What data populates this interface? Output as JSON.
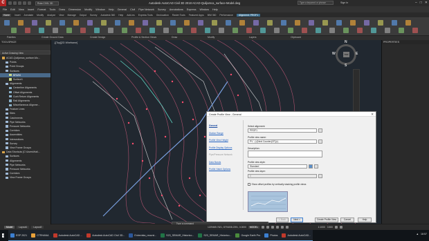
{
  "title_bar": {
    "workspace": "Ruta CIVIL 3D",
    "title": "Autodesk AutoCAD Civil 3D 2018   ACAD-Quiljamca_surface-Model.dwg",
    "search_placeholder": "Type a keyword or phrase",
    "sign_in": "Sign In",
    "window_buttons": [
      "–",
      "□",
      "✕"
    ]
  },
  "menu": [
    "File",
    "Edit",
    "View",
    "Insert",
    "Format",
    "Tools",
    "Draw",
    "Dimension",
    "Modify",
    "Window",
    "Help",
    "General",
    "Civil",
    "Pipe Network",
    "Survey",
    "Annotations",
    "Express",
    "Window",
    "Help"
  ],
  "ribbon_tabs": [
    "Home",
    "Insert",
    "Annotate",
    "Modify",
    "Analyze",
    "View",
    "Manage",
    "Output",
    "Survey",
    "Autodesk 360",
    "Help",
    "Add-ins",
    "Express Tools",
    "Geolocation",
    "Raster Tools",
    "Featured Apps",
    "BIM 360",
    "Performance"
  ],
  "ribbon_context_tab": "Alignment: PROF1",
  "ribbon_panels": [
    "Palettes",
    "Create Ground Data",
    "Create Design",
    "Profile & Section Views",
    "Draw",
    "Modify",
    "Layers",
    "Clipboard"
  ],
  "viewport_label": "-][Top][2D Wireframe]",
  "toolspace": {
    "title": "TOOLSPACE",
    "view_label": "Active Drawing View",
    "tree": [
      {
        "label": "ACAD-Quiljamca_surface-Mo...",
        "indent": 0,
        "sel": false,
        "color": "#d9a44a"
      },
      {
        "label": "Points",
        "indent": 1,
        "sel": false,
        "color": "#9fb9d6"
      },
      {
        "label": "Point Groups",
        "indent": 1,
        "sel": false,
        "color": "#9fb9d6"
      },
      {
        "label": "Surfaces",
        "indent": 1,
        "sel": false,
        "color": "#9fb9d6"
      },
      {
        "label": "BRUNI",
        "indent": 2,
        "sel": true,
        "color": "#c8d88a"
      },
      {
        "label": "Surface1",
        "indent": 2,
        "sel": false,
        "color": "#c8d88a"
      },
      {
        "label": "Alignments",
        "indent": 1,
        "sel": false,
        "color": "#9fb9d6"
      },
      {
        "label": "Centerline Alignments",
        "indent": 2,
        "sel": false,
        "color": "#8ab0c8"
      },
      {
        "label": "Offset Alignments",
        "indent": 2,
        "sel": false,
        "color": "#8ab0c8"
      },
      {
        "label": "Curb Return Alignments",
        "indent": 2,
        "sel": false,
        "color": "#8ab0c8"
      },
      {
        "label": "Rail Alignments",
        "indent": 2,
        "sel": false,
        "color": "#8ab0c8"
      },
      {
        "label": "Miscellaneous Alignme...",
        "indent": 2,
        "sel": false,
        "color": "#8ab0c8"
      },
      {
        "label": "Feature Lines",
        "indent": 1,
        "sel": false,
        "color": "#9fb9d6"
      },
      {
        "label": "Sites",
        "indent": 1,
        "sel": false,
        "color": "#9fb9d6"
      },
      {
        "label": "Catchments",
        "indent": 1,
        "sel": false,
        "color": "#9fb9d6"
      },
      {
        "label": "Pipe Networks",
        "indent": 1,
        "sel": false,
        "color": "#9fb9d6"
      },
      {
        "label": "Pressure Networks",
        "indent": 1,
        "sel": false,
        "color": "#9fb9d6"
      },
      {
        "label": "Corridors",
        "indent": 1,
        "sel": false,
        "color": "#9fb9d6"
      },
      {
        "label": "Assemblies",
        "indent": 1,
        "sel": false,
        "color": "#9fb9d6"
      },
      {
        "label": "Intersections",
        "indent": 1,
        "sel": false,
        "color": "#9fb9d6"
      },
      {
        "label": "Survey",
        "indent": 1,
        "sel": false,
        "color": "#9fb9d6"
      },
      {
        "label": "View Frame Groups",
        "indent": 1,
        "sel": false,
        "color": "#9fb9d6"
      },
      {
        "label": "Data Shortcuts [C:\\Users\\Hali...",
        "indent": 0,
        "sel": false,
        "color": "#d9a44a"
      },
      {
        "label": "Surfaces",
        "indent": 1,
        "sel": false,
        "color": "#9fb9d6"
      },
      {
        "label": "Alignments",
        "indent": 1,
        "sel": false,
        "color": "#9fb9d6"
      },
      {
        "label": "Pipe Networks",
        "indent": 1,
        "sel": false,
        "color": "#9fb9d6"
      },
      {
        "label": "Pressure Networks",
        "indent": 1,
        "sel": false,
        "color": "#9fb9d6"
      },
      {
        "label": "Corridors",
        "indent": 1,
        "sel": false,
        "color": "#9fb9d6"
      },
      {
        "label": "View Frame Groups",
        "indent": 1,
        "sel": false,
        "color": "#9fb9d6"
      }
    ]
  },
  "navcube": {
    "top": "TOP",
    "n": "N",
    "s": "S",
    "e": "E",
    "w": "W"
  },
  "properties_title": "PROPERTIES",
  "dialog": {
    "title": "Create Profile View - General",
    "close": "✕",
    "nav": [
      {
        "label": "General",
        "state": "active"
      },
      {
        "label": "Station Range",
        "state": "link"
      },
      {
        "label": "Profile View Height",
        "state": "link"
      },
      {
        "label": "Profile Display Options",
        "state": "link"
      },
      {
        "label": "Pipe/Pressure Network",
        "state": "disabled"
      },
      {
        "label": "Data Bands",
        "state": "link"
      },
      {
        "label": "Profile Hatch Options",
        "state": "link"
      }
    ],
    "select_alignment_label": "Select alignment:",
    "select_alignment_value": "PROF1",
    "profile_view_name_label": "Profile view name:",
    "profile_view_name_value": "PV - (<[Next Counter(CP)]>)",
    "description_label": "Description:",
    "description_value": "",
    "profile_view_style_label": "Profile view style:",
    "profile_view_style_value": "Standard",
    "profile_view_layer_label": "Profile view layer:",
    "profile_view_layer_value": "0",
    "show_offset_label": "Show offset profiles by vertically stacking profile views",
    "buttons": {
      "back": "< Back",
      "next": "Next >",
      "create": "Create Profile View",
      "cancel": "Cancel",
      "help": "Help"
    }
  },
  "command_line": "_ Type a command",
  "layout_tabs": [
    "Model",
    "Layout1",
    "Layout2"
  ],
  "status": {
    "coords": "1229465.7621, 8791838.2391, 0.0000",
    "model": "MODEL",
    "scale": "1:1000",
    "decimal": "3.500"
  },
  "taskbar": {
    "items": [
      {
        "label": "ESP 2021",
        "color": "#3c7fd1"
      },
      {
        "label": "CTRHANA",
        "color": "#e8a13a"
      },
      {
        "label": "Autodesk AutoCAD ...",
        "color": "#c0392b"
      },
      {
        "label": "Autodesk AutoCAD Civil 3D...",
        "color": "#c0392b"
      },
      {
        "label": "Entrevista_recursi...",
        "color": "#2b579a"
      },
      {
        "label": "S23_SEMAR_Historico...",
        "color": "#217346"
      },
      {
        "label": "S23_SEMAR_Historico...",
        "color": "#217346"
      },
      {
        "label": "Google Earth Pro",
        "color": "#4a8a3c"
      },
      {
        "label": "Photos",
        "color": "#3c7fd1"
      },
      {
        "label": "Autodesk AutoCAD...",
        "color": "#c0392b"
      }
    ],
    "time": "18:57"
  }
}
